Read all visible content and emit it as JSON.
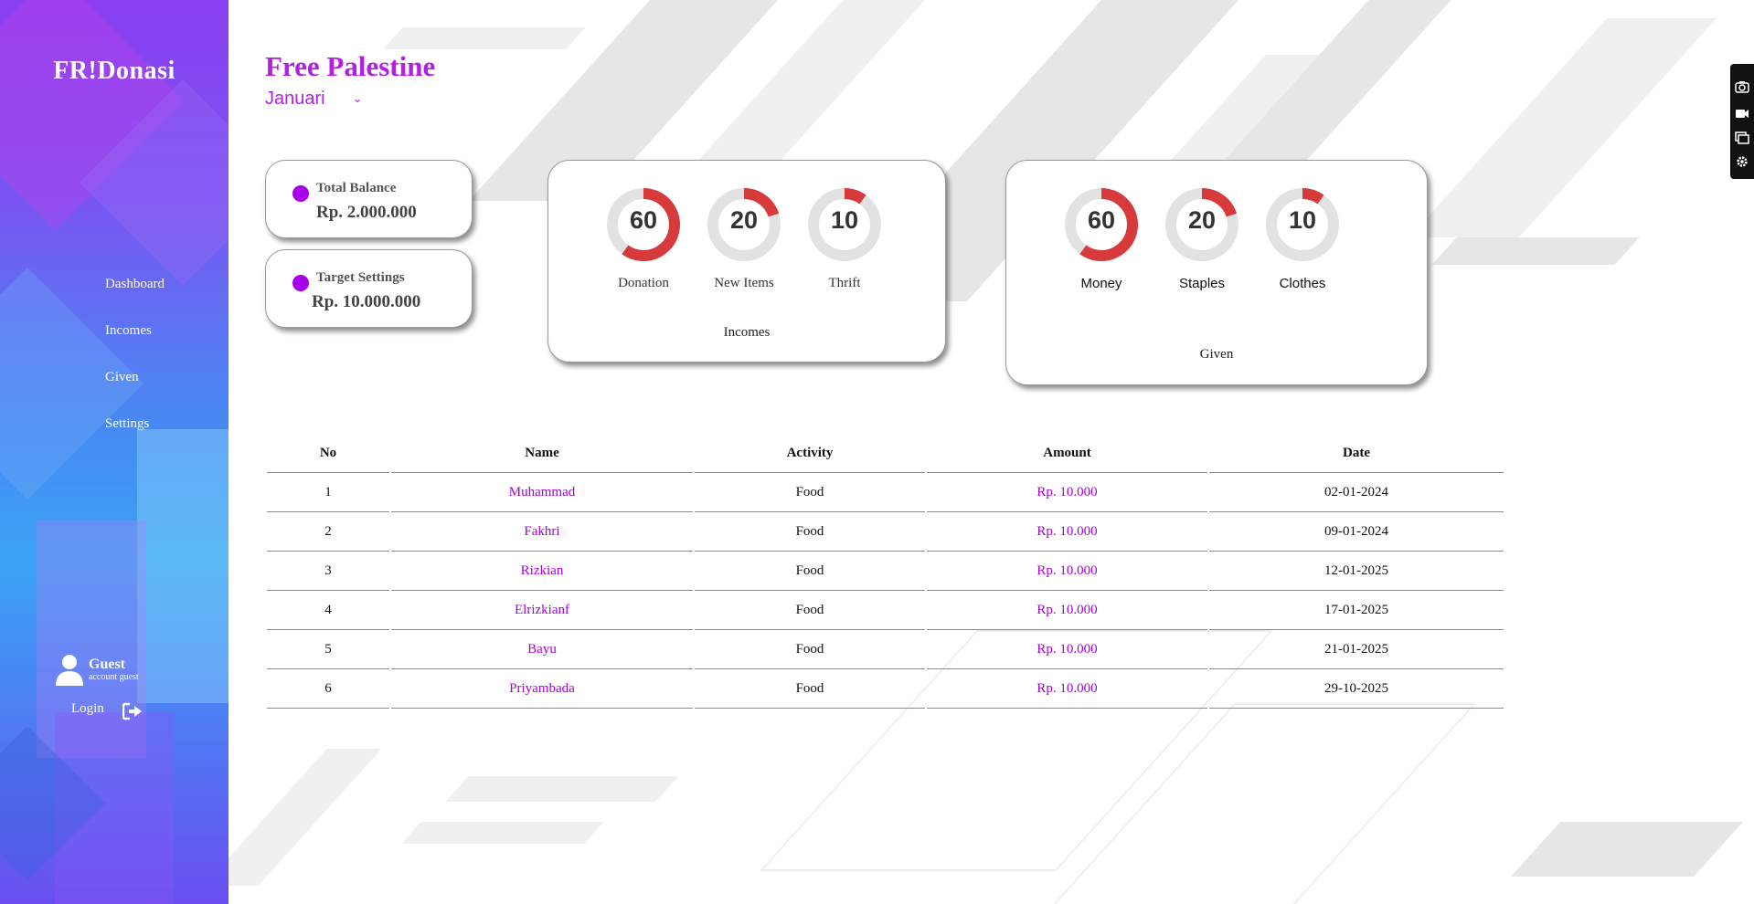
{
  "sidebar": {
    "brand": "FR!Donasi",
    "nav": [
      {
        "label": "Dashboard"
      },
      {
        "label": "Incomes"
      },
      {
        "label": "Given"
      },
      {
        "label": "Settings"
      }
    ],
    "user": {
      "name": "Guest",
      "role": "account guest"
    },
    "login_label": "Login",
    "icons": [
      "user-icon",
      "logout-icon"
    ]
  },
  "header": {
    "title": "Free Palestine",
    "month": "Januari"
  },
  "stats": [
    {
      "label": "Total Balance",
      "value": "Rp. 2.000.000"
    },
    {
      "label": "Target Settings",
      "value": "Rp. 10.000.000"
    }
  ],
  "incomes_card": {
    "caption": "Incomes",
    "items": [
      {
        "value": "60",
        "label": "Donation",
        "fraction": 0.6
      },
      {
        "value": "20",
        "label": "New Items",
        "fraction": 0.2
      },
      {
        "value": "10",
        "label": "Thrift",
        "fraction": 0.1
      }
    ]
  },
  "given_card": {
    "caption": "Given",
    "items": [
      {
        "value": "60",
        "label": "Money",
        "fraction": 0.6
      },
      {
        "value": "20",
        "label": "Staples",
        "fraction": 0.2
      },
      {
        "value": "10",
        "label": "Clothes",
        "fraction": 0.1
      }
    ]
  },
  "table": {
    "headers": [
      "No",
      "Name",
      "Activity",
      "Amount",
      "Date"
    ],
    "rows": [
      {
        "no": "1",
        "name": "Muhammad",
        "activity": "Food",
        "amount": "Rp. 10.000",
        "date": "02-01-2024"
      },
      {
        "no": "2",
        "name": "Fakhri",
        "activity": "Food",
        "amount": "Rp. 10.000",
        "date": "09-01-2024"
      },
      {
        "no": "3",
        "name": "Rizkian",
        "activity": "Food",
        "amount": "Rp. 10.000",
        "date": "12-01-2025"
      },
      {
        "no": "4",
        "name": "Elrizkianf",
        "activity": "Food",
        "amount": "Rp. 10.000",
        "date": "17-01-2025"
      },
      {
        "no": "5",
        "name": "Bayu",
        "activity": "Food",
        "amount": "Rp. 10.000",
        "date": "21-01-2025"
      },
      {
        "no": "6",
        "name": "Priyambada",
        "activity": "Food",
        "amount": "Rp. 10.000",
        "date": "29-10-2025"
      }
    ]
  },
  "colors": {
    "accent": "#b41fe6",
    "donut_fill": "#d63a3a",
    "donut_track": "#e2e2e2",
    "dot": "#a800e8"
  }
}
